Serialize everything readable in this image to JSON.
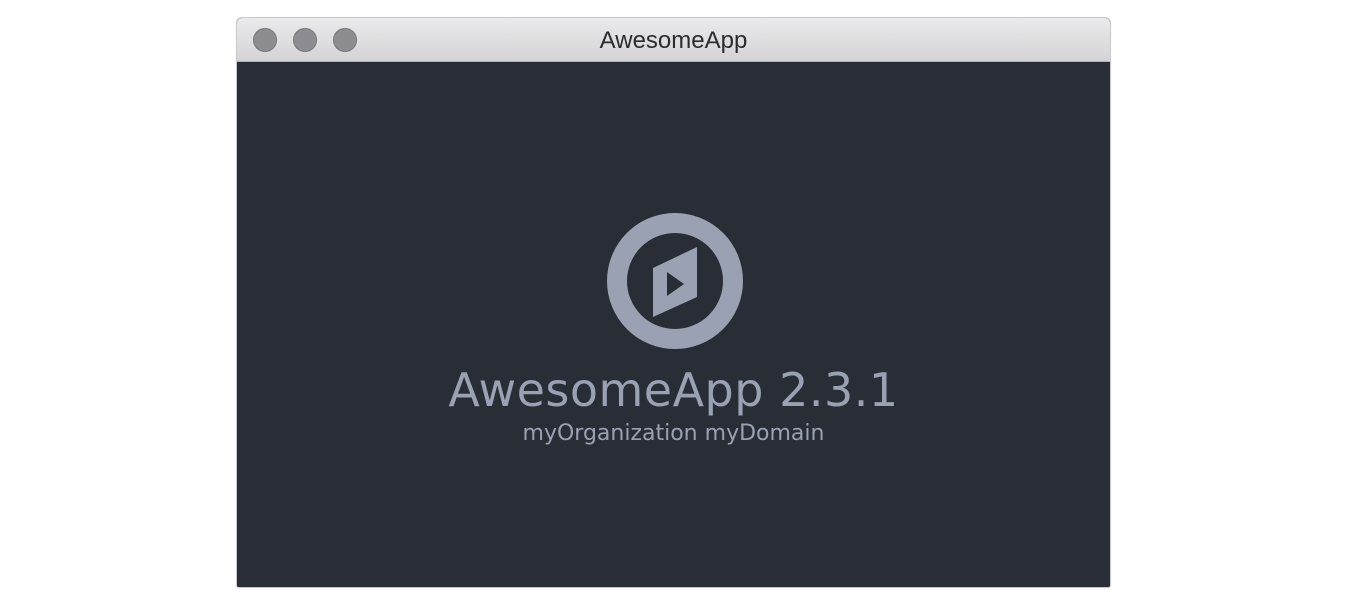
{
  "window": {
    "title": "AwesomeApp"
  },
  "splash": {
    "app_name": "AwesomeApp",
    "version": "2.3.1",
    "organization": "myOrganization",
    "domain": "myDomain"
  },
  "icons": {
    "logo": "play-ring-logo-icon",
    "close": "close-traffic-light-icon",
    "minimize": "minimize-traffic-light-icon",
    "zoom": "zoom-traffic-light-icon"
  },
  "colors": {
    "background": "#292d36",
    "foreground": "#9aa1b2",
    "titlebar": "#dedddf",
    "traffic_light": "#8d8c90"
  }
}
